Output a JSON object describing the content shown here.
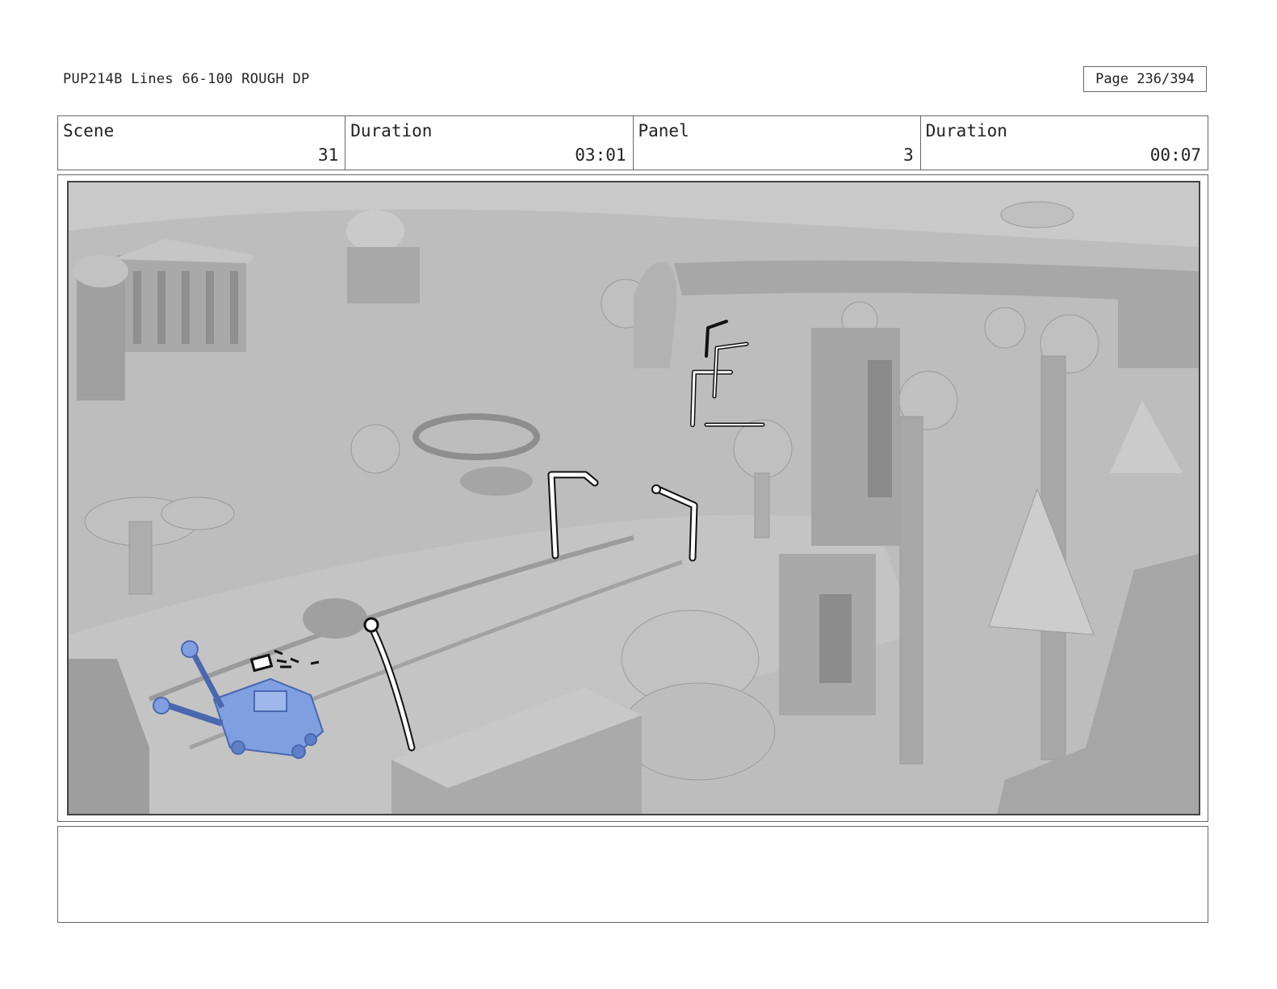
{
  "header": {
    "title": "PUP214B Lines 66-100 ROUGH DP",
    "page_label": "Page 236/394"
  },
  "info": {
    "scene_label": "Scene",
    "scene_value": "31",
    "scene_duration_label": "Duration",
    "scene_duration_value": "03:01",
    "panel_label": "Panel",
    "panel_value": "3",
    "panel_duration_label": "Duration",
    "panel_duration_value": "00:07"
  },
  "panel": {
    "colors": {
      "background": "#b9b9b9",
      "shade": "#9a9a9a",
      "light": "#d4d4d4",
      "tow_truck": "#7f9fe0",
      "lamp_outline": "#111111"
    }
  },
  "notes": {
    "text": ""
  }
}
